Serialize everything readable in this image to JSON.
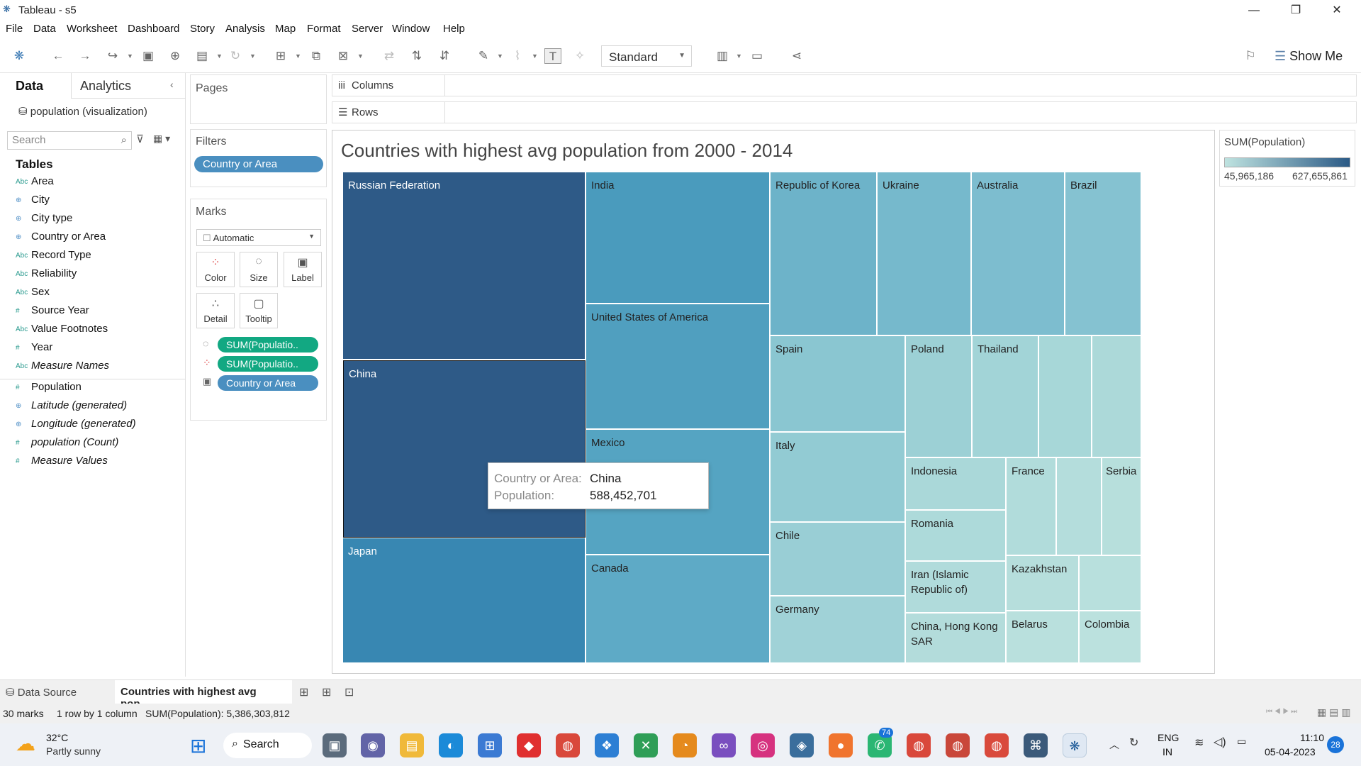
{
  "app": {
    "title": "Tableau - s5"
  },
  "menu": [
    "File",
    "Data",
    "Worksheet",
    "Dashboard",
    "Story",
    "Analysis",
    "Map",
    "Format",
    "Server",
    "Window",
    "Help"
  ],
  "toolbar": {
    "mark_size": "Standard",
    "show_me": "Show Me"
  },
  "data_pane": {
    "tabs": [
      "Data",
      "Analytics"
    ],
    "source": "population (visualization)",
    "search_placeholder": "Search",
    "tables_heading": "Tables",
    "fields": [
      {
        "type": "Abc",
        "name": "Area"
      },
      {
        "type": "geo",
        "name": "City"
      },
      {
        "type": "geo",
        "name": "City type"
      },
      {
        "type": "geo",
        "name": "Country or Area"
      },
      {
        "type": "Abc",
        "name": "Record Type"
      },
      {
        "type": "Abc",
        "name": "Reliability"
      },
      {
        "type": "Abc",
        "name": "Sex"
      },
      {
        "type": "#",
        "name": "Source Year"
      },
      {
        "type": "Abc",
        "name": "Value Footnotes"
      },
      {
        "type": "#",
        "name": "Year"
      },
      {
        "type": "Abc",
        "name": "Measure Names"
      },
      {
        "type": "#",
        "name": "Population"
      },
      {
        "type": "geo",
        "name": "Latitude (generated)"
      },
      {
        "type": "geo",
        "name": "Longitude (generated)"
      },
      {
        "type": "#",
        "name": "population (Count)"
      },
      {
        "type": "#",
        "name": "Measure Values"
      }
    ]
  },
  "cards": {
    "pages": "Pages",
    "filters": "Filters",
    "filter_pill": "Country or Area",
    "marks": "Marks",
    "mark_type": "Automatic",
    "mark_buttons": [
      "Color",
      "Size",
      "Label",
      "Detail",
      "Tooltip"
    ],
    "mark_pills": [
      "SUM(Populatio..",
      "SUM(Populatio..",
      "Country or Area"
    ]
  },
  "shelves": {
    "columns": "Columns",
    "rows": "Rows"
  },
  "chart_data": {
    "type": "treemap",
    "title": "Countries with highest avg population from 2000 - 2014",
    "measure": "SUM(Population)",
    "legend": {
      "title": "SUM(Population)",
      "min": "45,965,186",
      "max": "627,655,861"
    },
    "labels": [
      "Russian Federation",
      "China",
      "Japan",
      "India",
      "United States of America",
      "Mexico",
      "Canada",
      "Republic of Korea",
      "Ukraine",
      "Australia",
      "Brazil",
      "Spain",
      "Italy",
      "Chile",
      "Germany",
      "Poland",
      "Thailand",
      "Indonesia",
      "Romania",
      "Iran (Islamic Republic of)",
      "China, Hong Kong SAR",
      "France",
      "Serbia",
      "Kazakhstan",
      "Belarus",
      "Colombia"
    ]
  },
  "tooltip": {
    "k1": "Country or Area:",
    "v1": "China",
    "k2": "Population:",
    "v2": "588,452,701"
  },
  "sheet_tabs": {
    "data_source": "Data Source",
    "active": "Countries with highest avg pop..."
  },
  "status": {
    "marks": "30 marks",
    "layout": "1 row by 1 column",
    "sum": "SUM(Population): 5,386,303,812"
  },
  "taskbar": {
    "temp": "32°C",
    "weather": "Partly sunny",
    "search": "Search",
    "lang1": "ENG",
    "lang2": "IN",
    "time": "11:10",
    "date": "05-04-2023",
    "badge": "74",
    "notif": "28"
  }
}
